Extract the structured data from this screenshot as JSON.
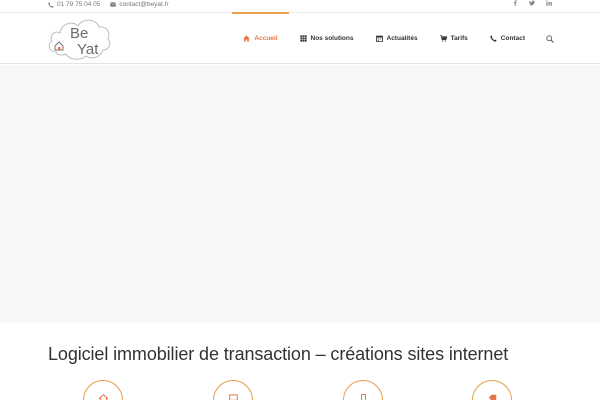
{
  "topbar": {
    "phone": "01 79 75 04 05",
    "email": "contact@beyat.fr",
    "social": [
      "facebook-icon",
      "twitter-icon",
      "linkedin-icon"
    ]
  },
  "logo": {
    "text_be": "Be",
    "text_yat": "Yat"
  },
  "nav": {
    "items": [
      {
        "label": "Accueil",
        "icon": "home-icon",
        "active": true
      },
      {
        "label": "Nos solutions",
        "icon": "grid-icon",
        "active": false
      },
      {
        "label": "Actualités",
        "icon": "calendar-icon",
        "active": false
      },
      {
        "label": "Tarifs",
        "icon": "cart-icon",
        "active": false
      },
      {
        "label": "Contact",
        "icon": "phone-icon",
        "active": false
      }
    ],
    "search_icon": "search-icon"
  },
  "main": {
    "title": "Logiciel immobilier de transaction – créations sites internet"
  },
  "features": [
    "home-icon",
    "monitor-icon",
    "mobile-icon",
    "tag-icon"
  ],
  "colors": {
    "accent": "#e8734a",
    "accent_border": "#e8a04a",
    "hero_bg": "#f7f7f7"
  }
}
